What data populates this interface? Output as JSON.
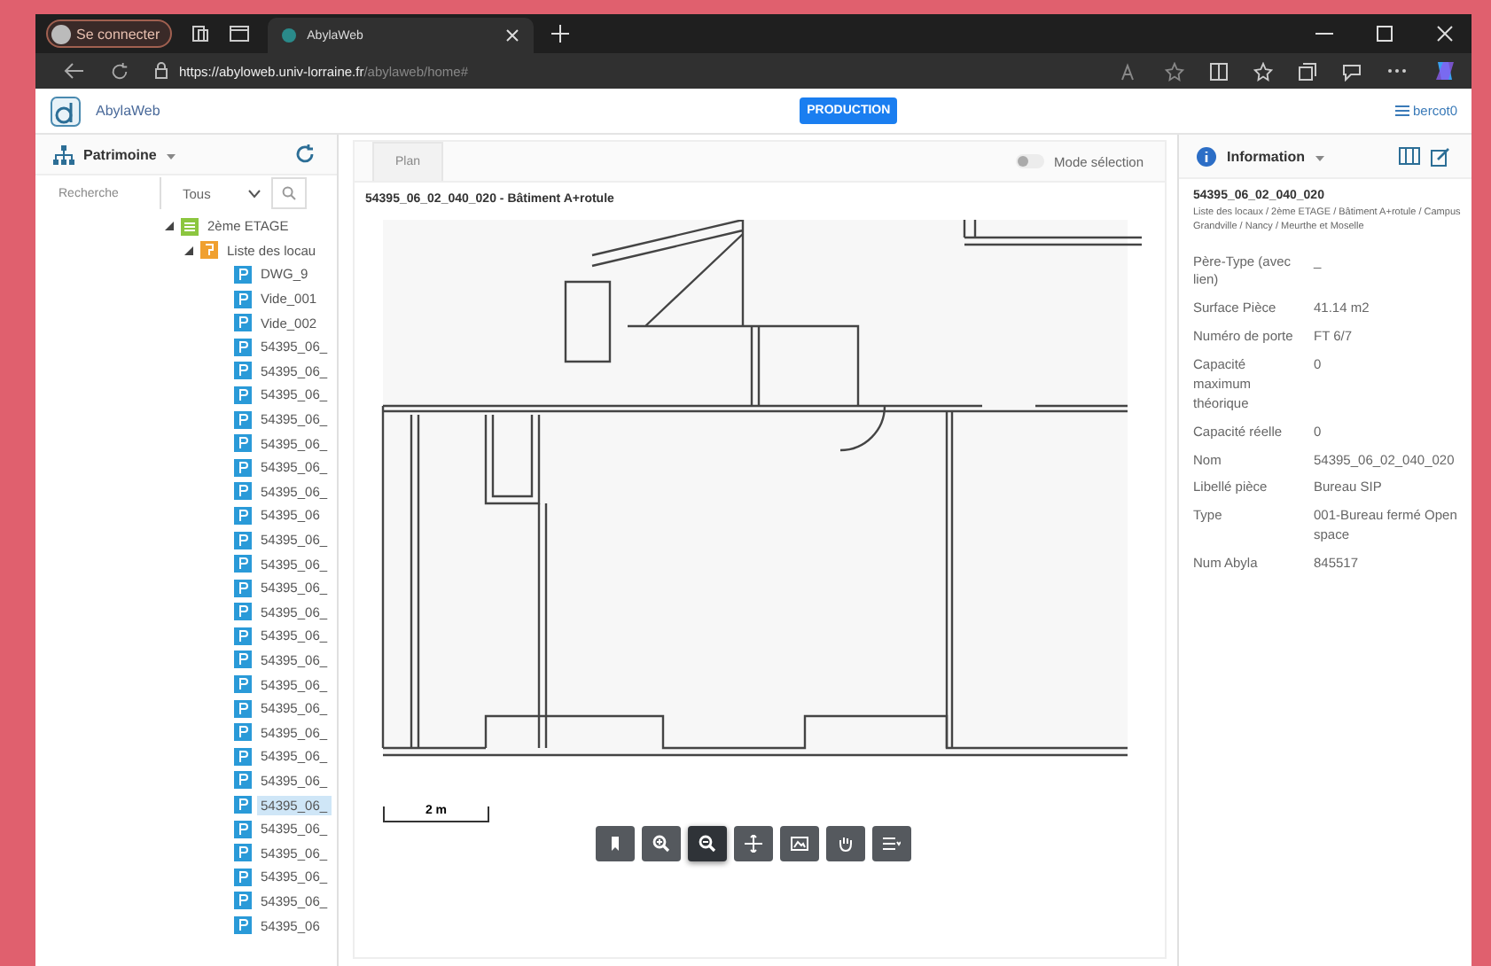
{
  "browser": {
    "profile": "Se connecter",
    "tab_title": "AbylaWeb",
    "url_host": "https://abyloweb.univ-lorraine.fr",
    "url_path": "/abylaweb/home#"
  },
  "app_header": {
    "title": "AbylaWeb",
    "environment": "PRODUCTION",
    "user": "bercot0"
  },
  "sidebar": {
    "title": "Patrimoine",
    "search": {
      "placeholder": "Recherche"
    },
    "filter": "Tous",
    "tree": [
      {
        "label": "2ème ETAGE",
        "expanded": true,
        "kind": "floor",
        "children": [
          {
            "label": "Liste des locau",
            "expanded": true,
            "kind": "list",
            "children": [
              {
                "label": "DWG_9",
                "selected": false
              },
              {
                "label": "Vide_001",
                "selected": false
              },
              {
                "label": "Vide_002",
                "selected": false
              },
              {
                "label": "54395_06_",
                "selected": false
              },
              {
                "label": "54395_06_",
                "selected": false
              },
              {
                "label": "54395_06_",
                "selected": false
              },
              {
                "label": "54395_06_",
                "selected": false
              },
              {
                "label": "54395_06_",
                "selected": false
              },
              {
                "label": "54395_06_",
                "selected": false
              },
              {
                "label": "54395_06_",
                "selected": false
              },
              {
                "label": "54395_06",
                "selected": false
              },
              {
                "label": "54395_06_",
                "selected": false
              },
              {
                "label": "54395_06_",
                "selected": false
              },
              {
                "label": "54395_06_",
                "selected": false
              },
              {
                "label": "54395_06_",
                "selected": false
              },
              {
                "label": "54395_06_",
                "selected": false
              },
              {
                "label": "54395_06_",
                "selected": false
              },
              {
                "label": "54395_06_",
                "selected": false
              },
              {
                "label": "54395_06_",
                "selected": false
              },
              {
                "label": "54395_06_",
                "selected": false
              },
              {
                "label": "54395_06_",
                "selected": false
              },
              {
                "label": "54395_06_",
                "selected": false
              },
              {
                "label": "54395_06_",
                "selected": true
              },
              {
                "label": "54395_06_",
                "selected": false
              },
              {
                "label": "54395_06_",
                "selected": false
              },
              {
                "label": "54395_06_",
                "selected": false
              },
              {
                "label": "54395_06_",
                "selected": false
              },
              {
                "label": "54395_06",
                "selected": false
              }
            ]
          }
        ]
      }
    ]
  },
  "plan": {
    "tab": "Plan",
    "mode_toggle": {
      "label": "Mode sélection",
      "on": false
    },
    "title": "54395_06_02_040_020 - Bâtiment A+rotule",
    "scale": "2 m",
    "tools": [
      {
        "kind": "bookmark",
        "selected": false
      },
      {
        "kind": "zoom-in",
        "selected": false
      },
      {
        "kind": "zoom-out",
        "selected": true
      },
      {
        "kind": "move",
        "selected": false
      },
      {
        "kind": "image",
        "selected": false
      },
      {
        "kind": "hand",
        "selected": false
      },
      {
        "kind": "layers",
        "selected": false
      }
    ]
  },
  "info": {
    "title": "Information",
    "room_code": "54395_06_02_040_020",
    "breadcrumb": "Liste des locaux / 2ème ETAGE / Bâtiment A+rotule / Campus Grandville / Nancy / Meurthe et Moselle",
    "fields": [
      {
        "label": "Père-Type (avec lien)",
        "value": "_"
      },
      {
        "label": "Surface Pièce",
        "value": "41.14 m2"
      },
      {
        "label": "Numéro de porte",
        "value": "FT 6/7"
      },
      {
        "label": "Capacité maximum théorique",
        "value": "0"
      },
      {
        "label": "Capacité réelle",
        "value": "0"
      },
      {
        "label": "Nom",
        "value": "54395_06_02_040_020"
      },
      {
        "label": "Libellé pièce",
        "value": "Bureau SIP"
      },
      {
        "label": "Type",
        "value": "001-Bureau fermé Open space"
      },
      {
        "label": "Num Abyla",
        "value": "845517"
      }
    ]
  }
}
